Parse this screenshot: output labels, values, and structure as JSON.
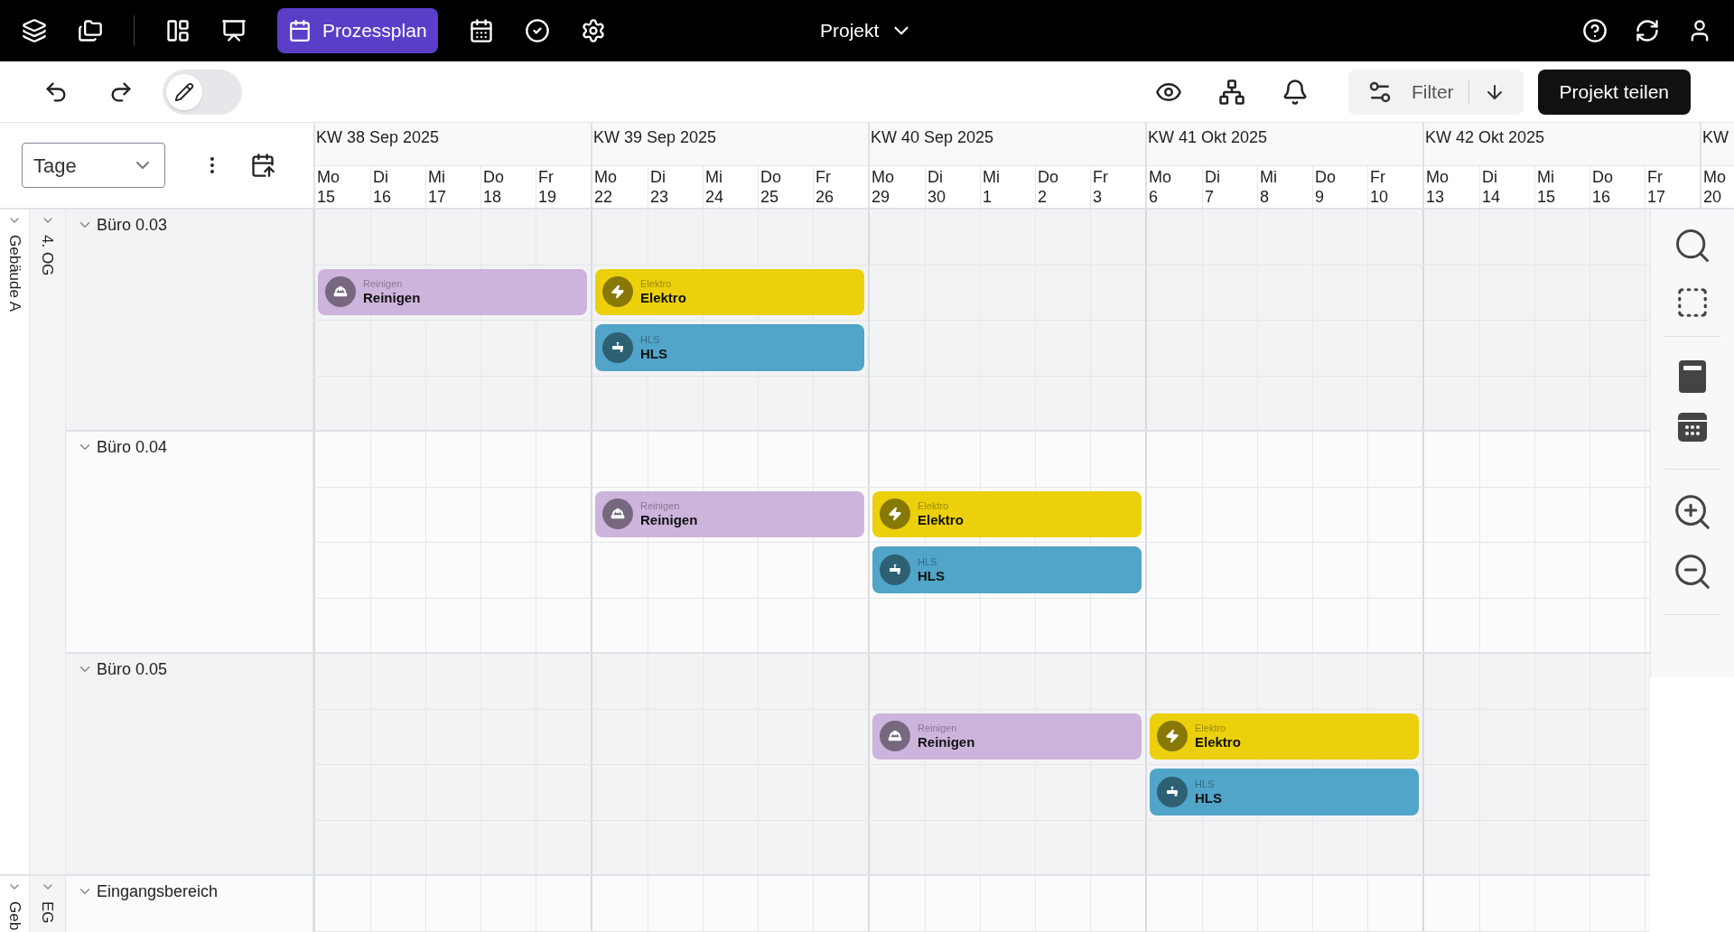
{
  "nav_items": [
    {
      "selected": false
    },
    {
      "selected": false
    },
    {
      "selected": false
    },
    {
      "selected": false
    },
    {
      "label": "Prozessplan",
      "selected": true
    },
    {
      "selected": false
    },
    {
      "selected": false
    },
    {
      "selected": false
    }
  ],
  "project_menu": {
    "label": "Projekt"
  },
  "edit_toggle": {
    "on": false
  },
  "filter": {
    "label": "Filter"
  },
  "share_button": {
    "label": "Projekt teilen"
  },
  "view_select": {
    "value": "Tage"
  },
  "weeks": [
    {
      "label": "KW 38 Sep 2025",
      "days": [
        {
          "weekday": "Mo",
          "date": "15"
        },
        {
          "weekday": "Di",
          "date": "16"
        },
        {
          "weekday": "Mi",
          "date": "17"
        },
        {
          "weekday": "Do",
          "date": "18"
        },
        {
          "weekday": "Fr",
          "date": "19"
        }
      ]
    },
    {
      "label": "KW 39 Sep 2025",
      "days": [
        {
          "weekday": "Mo",
          "date": "22"
        },
        {
          "weekday": "Di",
          "date": "23"
        },
        {
          "weekday": "Mi",
          "date": "24"
        },
        {
          "weekday": "Do",
          "date": "25"
        },
        {
          "weekday": "Fr",
          "date": "26"
        }
      ]
    },
    {
      "label": "KW 40 Sep 2025",
      "days": [
        {
          "weekday": "Mo",
          "date": "29"
        },
        {
          "weekday": "Di",
          "date": "30"
        },
        {
          "weekday": "Mi",
          "date": "1"
        },
        {
          "weekday": "Do",
          "date": "2"
        },
        {
          "weekday": "Fr",
          "date": "3"
        }
      ]
    },
    {
      "label": "KW 41 Okt 2025",
      "days": [
        {
          "weekday": "Mo",
          "date": "6"
        },
        {
          "weekday": "Di",
          "date": "7"
        },
        {
          "weekday": "Mi",
          "date": "8"
        },
        {
          "weekday": "Do",
          "date": "9"
        },
        {
          "weekday": "Fr",
          "date": "10"
        }
      ]
    },
    {
      "label": "KW 42 Okt 2025",
      "days": [
        {
          "weekday": "Mo",
          "date": "13"
        },
        {
          "weekday": "Di",
          "date": "14"
        },
        {
          "weekday": "Mi",
          "date": "15"
        },
        {
          "weekday": "Do",
          "date": "16"
        },
        {
          "weekday": "Fr",
          "date": "17"
        }
      ]
    },
    {
      "label": "KW",
      "days": [
        {
          "weekday": "Mo",
          "date": "20"
        }
      ]
    }
  ],
  "buildings": [
    {
      "label": "Gebäude A",
      "expanded": true,
      "floors": [
        {
          "label": "4. OG",
          "expanded": true,
          "rooms": [
            {
              "name": "Büro 0.03",
              "expanded": true,
              "lanes": [
                [
                  {
                    "kind": "reinigen",
                    "category": "Reinigen",
                    "title": "Reinigen",
                    "color": "#cdb4dc"
                  },
                  {
                    "kind": "elektro",
                    "category": "Elektro",
                    "title": "Elektro",
                    "color": "#ebd00b"
                  },
                  {
                    "kind": "free"
                  },
                  {
                    "kind": "free"
                  },
                  {
                    "kind": "free"
                  }
                ],
                [
                  {
                    "kind": "free"
                  },
                  {
                    "kind": "hls",
                    "category": "HLS",
                    "title": "HLS",
                    "color": "#50a5c8"
                  },
                  {
                    "kind": "free"
                  },
                  {
                    "kind": "free"
                  },
                  {
                    "kind": "free"
                  }
                ]
              ]
            },
            {
              "name": "Büro 0.04",
              "expanded": true,
              "lanes": [
                [
                  {
                    "kind": "free"
                  },
                  {
                    "kind": "reinigen",
                    "category": "Reinigen",
                    "title": "Reinigen",
                    "color": "#cdb4dc"
                  },
                  {
                    "kind": "elektro",
                    "category": "Elektro",
                    "title": "Elektro",
                    "color": "#ebd00b"
                  },
                  {
                    "kind": "free"
                  },
                  {
                    "kind": "free"
                  }
                ],
                [
                  {
                    "kind": "free"
                  },
                  {
                    "kind": "free"
                  },
                  {
                    "kind": "hls",
                    "category": "HLS",
                    "title": "HLS",
                    "color": "#50a5c8"
                  },
                  {
                    "kind": "free"
                  },
                  {
                    "kind": "free"
                  }
                ]
              ]
            },
            {
              "name": "Büro 0.05",
              "expanded": true,
              "lanes": [
                [
                  {
                    "kind": "free"
                  },
                  {
                    "kind": "free"
                  },
                  {
                    "kind": "reinigen",
                    "category": "Reinigen",
                    "title": "Reinigen",
                    "color": "#cdb4dc"
                  },
                  {
                    "kind": "elektro",
                    "category": "Elektro",
                    "title": "Elektro",
                    "color": "#ebd00b"
                  },
                  {
                    "kind": "free"
                  }
                ],
                [
                  {
                    "kind": "free"
                  },
                  {
                    "kind": "free"
                  },
                  {
                    "kind": "free"
                  },
                  {
                    "kind": "hls",
                    "category": "HLS",
                    "title": "HLS",
                    "color": "#50a5c8"
                  },
                  {
                    "kind": "free"
                  }
                ]
              ]
            }
          ]
        }
      ]
    },
    {
      "label": "Geb",
      "expanded": true,
      "floors": [
        {
          "label": "EG",
          "expanded": true,
          "rooms": [
            {
              "name": "Eingangsbereich",
              "expanded": true
            }
          ]
        }
      ]
    }
  ]
}
